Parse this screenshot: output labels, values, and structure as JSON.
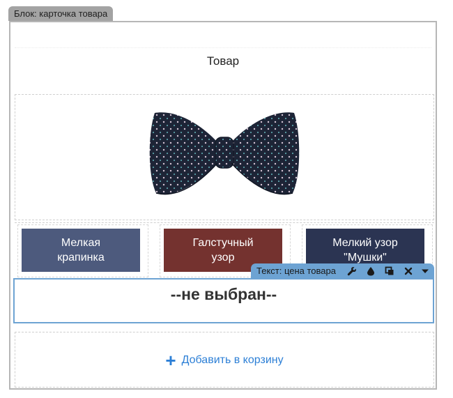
{
  "block_label": "Блок: карточка товара",
  "product": {
    "title": "Товар",
    "image_alt": "bow-tie"
  },
  "variants": [
    {
      "label": "Мелкая\nкрапинка",
      "color": "#4d5a7d"
    },
    {
      "label": "Галстучный\nузор",
      "color": "#74322f"
    },
    {
      "label": "Мелкий узор\n\"Мушки\"",
      "color": "#2b3452"
    }
  ],
  "toolbar": {
    "label": "Текст: цена товара",
    "icons": [
      "wrench-icon",
      "drop-icon",
      "copy-icon",
      "close-icon",
      "caret-down-icon"
    ]
  },
  "price": {
    "value": "--не выбран--"
  },
  "cart": {
    "plus": "+",
    "label": "Добавить в корзину"
  },
  "colors": {
    "accent": "#6da3d3",
    "link": "#2c7fd6"
  }
}
